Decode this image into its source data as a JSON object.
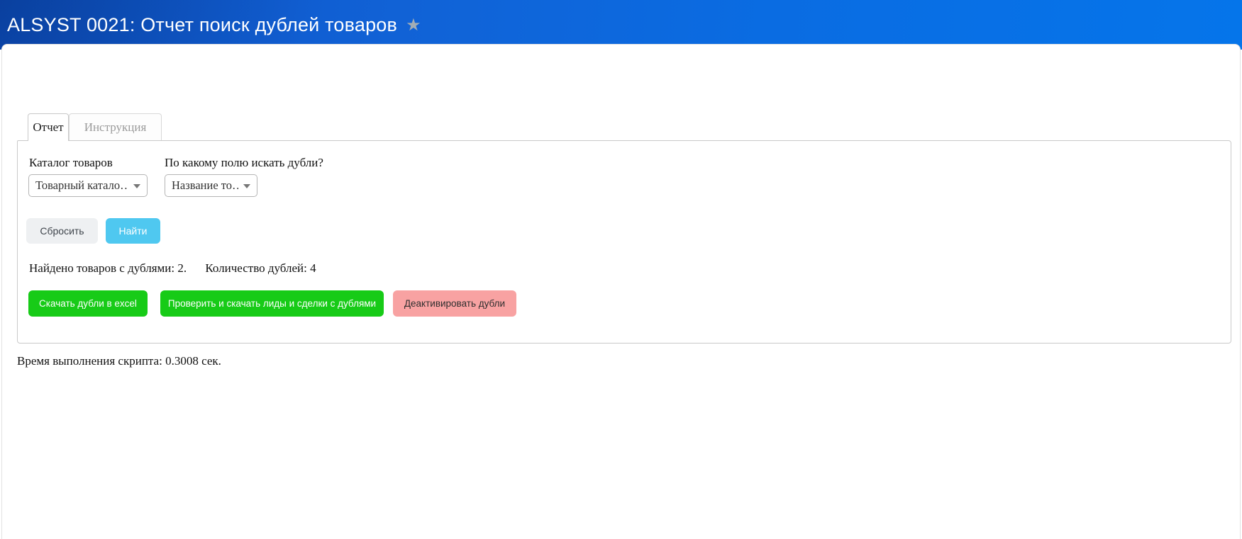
{
  "header": {
    "title": "ALSYST 0021: Отчет поиск дублей товаров",
    "star_icon": "★"
  },
  "tabs": [
    {
      "label": "Отчет",
      "active": true
    },
    {
      "label": "Инструкция",
      "active": false
    }
  ],
  "form": {
    "catalog_label": "Каталог товаров",
    "catalog_value": "Товарный катало…",
    "field_label": "По какому полю искать дубли?",
    "field_value": "Название то…",
    "reset_label": "Сбросить",
    "find_label": "Найти"
  },
  "results": {
    "found_text": "Найдено товаров с дублями: 2.",
    "count_text": "Количество дублей: 4",
    "download_excel_label": "Скачать дубли в excel",
    "check_leads_label": "Проверить и скачать лиды и сделки с дублями",
    "deactivate_label": "Деактивировать дубли"
  },
  "footer": {
    "execution_time_text": "Время выполнения скрипта: 0.3008 сек."
  },
  "colors": {
    "header_gradient_left": "#0d51c4",
    "header_gradient_right": "#0575ea",
    "find_button": "#4fc8f0",
    "reset_button": "#eef0f2",
    "green_button": "#17cb17",
    "pink_button": "#f8a2a2"
  }
}
